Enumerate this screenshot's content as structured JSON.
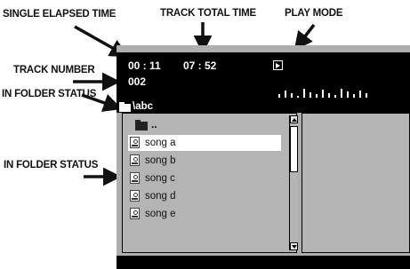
{
  "callouts": {
    "single_elapsed_time": "SINGLE ELAPSED TIME",
    "track_total_time": "TRACK TOTAL TIME",
    "play_mode": "PLAY MODE",
    "track_number": "TRACK NUMBER",
    "in_folder_status_top": "IN FOLDER STATUS",
    "in_folder_status_list": "IN FOLDER STATUS"
  },
  "header": {
    "elapsed_time": "00 : 11",
    "total_time": "07 : 52",
    "track_number": "002",
    "play_mode_icon": "play-mode-icon",
    "equalizer_levels": [
      0.35,
      0.7,
      0.45,
      0.2,
      0.85,
      0.5,
      0.3,
      0.75,
      0.4,
      0.25,
      0.8,
      0.55,
      0.3,
      0.7,
      0.4
    ]
  },
  "folder_path": "\\abc",
  "file_list": {
    "parent": "..",
    "items": [
      {
        "name": "song a",
        "icon": "mp3-file-icon",
        "selected": true
      },
      {
        "name": "song b",
        "icon": "mp3-file-icon",
        "selected": false
      },
      {
        "name": "song c",
        "icon": "mp3-file-icon",
        "selected": false
      },
      {
        "name": "song d",
        "icon": "mp3-file-icon",
        "selected": false
      },
      {
        "name": "song e",
        "icon": "mp3-file-icon",
        "selected": false
      }
    ]
  },
  "scrollbar": {
    "position": 0.0
  },
  "colors": {
    "screen_bg": "#aeaeae",
    "bar_bg": "#000000",
    "selected_row": "#ffffff"
  }
}
